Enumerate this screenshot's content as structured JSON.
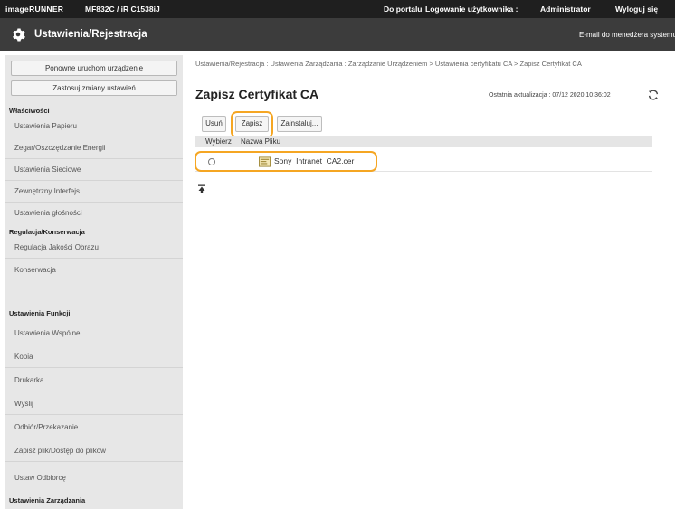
{
  "topbar": {
    "brand": "imageRUNNER",
    "model": "MF832C / iR C1538iJ",
    "portal_link": "Do portalu",
    "login_label": "Logowanie użytkownika :",
    "user": "Administrator",
    "logout": "Wyloguj się"
  },
  "header": {
    "title": "Ustawienia/Rejestracja",
    "email_link": "E-mail do menedżera systemu"
  },
  "sidebar": {
    "buttons": [
      "Ponowne uruchom urządzenie",
      "Zastosuj zmiany ustawień"
    ],
    "sections": [
      {
        "title": "Właściwości",
        "items": [
          "Ustawienia Papieru",
          "Zegar/Oszczędzanie Energii",
          "Ustawienia Sieciowe",
          "Zewnętrzny Interfejs",
          "Ustawienia głośności"
        ]
      },
      {
        "title": "Regulacja/Konserwacja",
        "items": [
          "Regulacja Jakości Obrazu",
          "Konserwacja"
        ]
      },
      {
        "title": "Ustawienia Funkcji",
        "items": [
          "Ustawienia Wspólne",
          "Kopia",
          "Drukarka",
          "Wyślij",
          "Odbiór/Przekazanie",
          "Zapisz plik/Dostęp do plików",
          "Ustaw Odbiorcę"
        ]
      },
      {
        "title": "Ustawienia Zarządzania",
        "items": []
      }
    ]
  },
  "main": {
    "breadcrumb": "Ustawienia/Rejestracja : Ustawienia Zarządzania : Zarządzanie Urządzeniem > Ustawienia certyfikatu CA > Zapisz Certyfikat CA",
    "title": "Zapisz Certyfikat CA",
    "updated": "Ostatnia aktualizacja : 07/12 2020 10:36:02",
    "buttons": {
      "delete": "Usuń",
      "save": "Zapisz",
      "install": "Zainstaluj..."
    },
    "table": {
      "columns": [
        "Wybierz",
        "Nazwa Pliku"
      ],
      "rows": [
        {
          "file_name": "Sony_Intranet_CA2.cer"
        }
      ]
    }
  },
  "colors": {
    "highlight": "#f5a623",
    "topbar": "#1f1f1f",
    "headerbar": "#3c3c3c",
    "sidebar": "#e7e7e7"
  },
  "icons": [
    "gear-icon",
    "refresh-icon",
    "file-icon",
    "back-to-top-icon"
  ]
}
